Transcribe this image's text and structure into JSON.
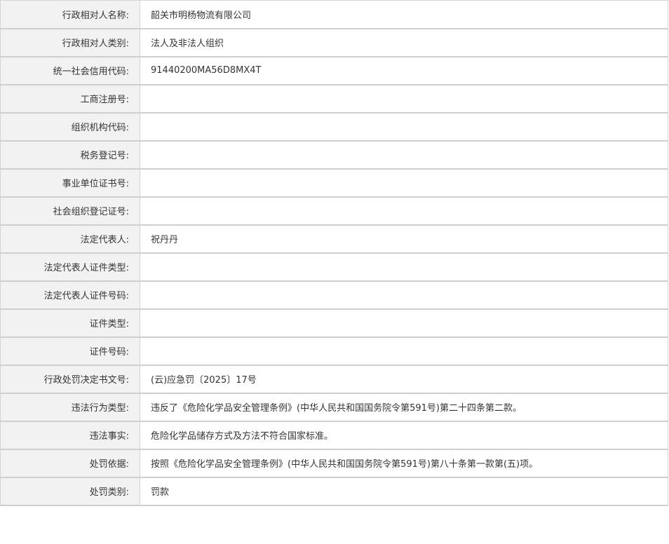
{
  "rows": [
    {
      "label": "行政相对人名称:",
      "value": "韶关市明杨物流有限公司"
    },
    {
      "label": "行政相对人类别:",
      "value": "法人及非法人组织"
    },
    {
      "label": "统一社会信用代码:",
      "value": "91440200MA56D8MX4T"
    },
    {
      "label": "工商注册号:",
      "value": ""
    },
    {
      "label": "组织机构代码:",
      "value": ""
    },
    {
      "label": "税务登记号:",
      "value": ""
    },
    {
      "label": "事业单位证书号:",
      "value": ""
    },
    {
      "label": "社会组织登记证号:",
      "value": ""
    },
    {
      "label": "法定代表人:",
      "value": "祝丹丹"
    },
    {
      "label": "法定代表人证件类型:",
      "value": ""
    },
    {
      "label": "法定代表人证件号码:",
      "value": ""
    },
    {
      "label": "证件类型:",
      "value": ""
    },
    {
      "label": "证件号码:",
      "value": ""
    },
    {
      "label": "行政处罚决定书文号:",
      "value": "(云)应急罚〔2025〕17号"
    },
    {
      "label": "违法行为类型:",
      "value": "违反了《危险化学品安全管理条例》(中华人民共和国国务院令第591号)第二十四条第二款。"
    },
    {
      "label": "违法事实:",
      "value": "危险化学品储存方式及方法不符合国家标准。"
    },
    {
      "label": "处罚依据:",
      "value": "按照《危险化学品安全管理条例》(中华人民共和国国务院令第591号)第八十条第一款第(五)项。"
    },
    {
      "label": "处罚类别:",
      "value": "罚款"
    }
  ]
}
